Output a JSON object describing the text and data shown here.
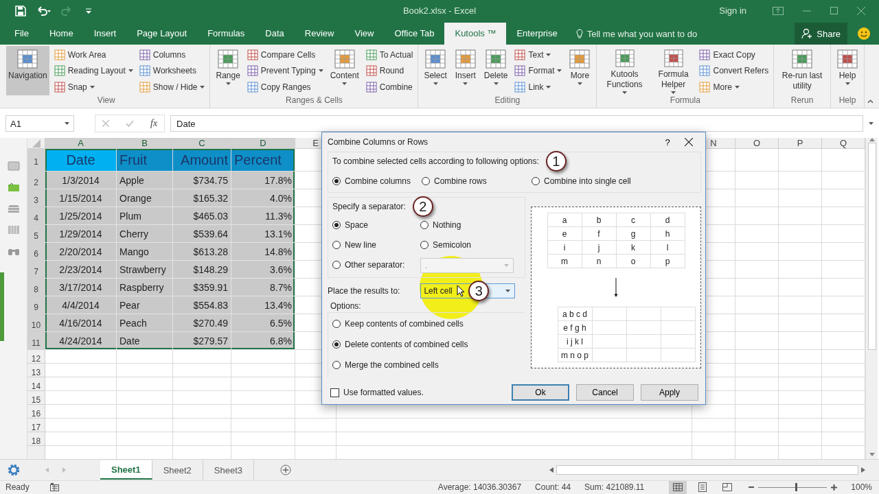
{
  "window": {
    "title": "Book2.xlsx  -  Excel",
    "sign_in": "Sign in"
  },
  "ribbon_tabs": [
    {
      "label": "File",
      "selected": false
    },
    {
      "label": "Home",
      "selected": false
    },
    {
      "label": "Insert",
      "selected": false
    },
    {
      "label": "Page Layout",
      "selected": false
    },
    {
      "label": "Formulas",
      "selected": false
    },
    {
      "label": "Data",
      "selected": false
    },
    {
      "label": "Review",
      "selected": false
    },
    {
      "label": "View",
      "selected": false
    },
    {
      "label": "Office Tab",
      "selected": false
    },
    {
      "label": "Kutools ™",
      "selected": true
    },
    {
      "label": "Enterprise",
      "selected": false
    }
  ],
  "tell_me": {
    "placeholder": "Tell me what you want to do"
  },
  "share": "Share",
  "ribbon": {
    "groups": [
      {
        "label": "View",
        "items": [
          {
            "kind": "large",
            "label": "Navigation",
            "dropdown": false,
            "on": true
          },
          {
            "kind": "stack",
            "items": [
              {
                "label": "Work Area",
                "dropdown": false,
                "on": false
              },
              {
                "label": "Reading Layout",
                "dropdown": true,
                "on": false
              },
              {
                "label": "Snap",
                "dropdown": true,
                "on": false
              }
            ]
          },
          {
            "kind": "stack",
            "items": [
              {
                "label": "Columns",
                "dropdown": false,
                "on": false
              },
              {
                "label": "Worksheets",
                "dropdown": false,
                "on": false
              },
              {
                "label": "Show / Hide",
                "dropdown": true,
                "on": false
              }
            ]
          }
        ]
      },
      {
        "label": "Ranges & Cells",
        "items": [
          {
            "kind": "large",
            "label": "Range",
            "dropdown": true,
            "on": false
          },
          {
            "kind": "stack",
            "items": [
              {
                "label": "Compare Cells",
                "dropdown": false,
                "on": false
              },
              {
                "label": "Prevent Typing",
                "dropdown": true,
                "on": false
              },
              {
                "label": "Copy Ranges",
                "dropdown": false,
                "on": false
              }
            ]
          },
          {
            "kind": "large",
            "label": "Content",
            "dropdown": true,
            "on": false
          },
          {
            "kind": "stack",
            "items": [
              {
                "label": "To Actual",
                "dropdown": false,
                "on": false
              },
              {
                "label": "Round",
                "dropdown": false,
                "on": false
              },
              {
                "label": "Combine",
                "dropdown": false,
                "on": false
              }
            ]
          }
        ]
      },
      {
        "label": "Editing",
        "items": [
          {
            "kind": "large",
            "label": "Select",
            "dropdown": true,
            "on": false
          },
          {
            "kind": "large",
            "label": "Insert",
            "dropdown": true,
            "on": false
          },
          {
            "kind": "large",
            "label": "Delete",
            "dropdown": true,
            "on": false
          },
          {
            "kind": "stack",
            "items": [
              {
                "label": "Text",
                "dropdown": true,
                "on": false
              },
              {
                "label": "Format",
                "dropdown": true,
                "on": false
              },
              {
                "label": "Link",
                "dropdown": true,
                "on": false
              }
            ]
          },
          {
            "kind": "large",
            "label": "More",
            "dropdown": true,
            "on": false
          }
        ]
      },
      {
        "label": "Formula",
        "items": [
          {
            "kind": "large",
            "label": "Kutools Functions",
            "dropdown": true,
            "on": false
          },
          {
            "kind": "large",
            "label": "Formula Helper",
            "dropdown": true,
            "on": false
          },
          {
            "kind": "stack",
            "items": [
              {
                "label": "Exact Copy",
                "dropdown": false,
                "on": false
              },
              {
                "label": "Convert Refers",
                "dropdown": false,
                "on": false
              },
              {
                "label": "More",
                "dropdown": true,
                "on": false
              }
            ]
          }
        ]
      },
      {
        "label": "Rerun",
        "items": [
          {
            "kind": "large",
            "label": "Re-run last utility",
            "dropdown": false,
            "on": false
          }
        ]
      },
      {
        "label": "Help",
        "items": [
          {
            "kind": "large",
            "label": "Help",
            "dropdown": true,
            "on": false
          }
        ]
      }
    ]
  },
  "formula_bar": {
    "name_box": "A1",
    "fx": "fx",
    "value": "Date"
  },
  "sheet": {
    "columns": [
      {
        "label": "A",
        "selected": true
      },
      {
        "label": "B",
        "selected": true
      },
      {
        "label": "C",
        "selected": true
      },
      {
        "label": "D",
        "selected": true
      },
      {
        "label": "E",
        "selected": false
      },
      {
        "label": "N",
        "selected": false
      },
      {
        "label": "O",
        "selected": false
      },
      {
        "label": "P",
        "selected": false
      },
      {
        "label": "Q",
        "selected": false
      }
    ],
    "rows": [
      {
        "number": "1",
        "selected": true,
        "cells": [
          "Date",
          "Fruit",
          "Amount",
          "Percent"
        ]
      },
      {
        "number": "2",
        "selected": true,
        "cells": [
          "1/3/2014",
          "Apple",
          "$734.75",
          "17.8%"
        ]
      },
      {
        "number": "3",
        "selected": true,
        "cells": [
          "1/15/2014",
          "Orange",
          "$165.32",
          "4.0%"
        ]
      },
      {
        "number": "4",
        "selected": true,
        "cells": [
          "1/25/2014",
          "Plum",
          "$465.03",
          "11.3%"
        ]
      },
      {
        "number": "5",
        "selected": true,
        "cells": [
          "1/29/2014",
          "Cherry",
          "$539.64",
          "13.1%"
        ]
      },
      {
        "number": "6",
        "selected": true,
        "cells": [
          "2/20/2014",
          "Mango",
          "$613.28",
          "14.8%"
        ]
      },
      {
        "number": "7",
        "selected": true,
        "cells": [
          "2/23/2014",
          "Strawberry",
          "$148.29",
          "3.6%"
        ]
      },
      {
        "number": "8",
        "selected": true,
        "cells": [
          "3/17/2014",
          "Raspberry",
          "$359.91",
          "8.7%"
        ]
      },
      {
        "number": "9",
        "selected": true,
        "cells": [
          "4/4/2014",
          "Pear",
          "$554.83",
          "13.4%"
        ]
      },
      {
        "number": "10",
        "selected": true,
        "cells": [
          "4/16/2014",
          "Peach",
          "$270.49",
          "6.5%"
        ]
      },
      {
        "number": "11",
        "selected": true,
        "cells": [
          "4/24/2014",
          "Date",
          "$279.57",
          "6.8%"
        ]
      },
      {
        "number": "12",
        "selected": false
      },
      {
        "number": "13",
        "selected": false
      },
      {
        "number": "14",
        "selected": false
      },
      {
        "number": "15",
        "selected": false
      },
      {
        "number": "16",
        "selected": false
      },
      {
        "number": "17",
        "selected": false
      },
      {
        "number": "18",
        "selected": false
      }
    ]
  },
  "dialog": {
    "title": "Combine Columns or Rows",
    "help": "?",
    "combine": {
      "label": "To combine selected cells according to following options:",
      "callout": "1",
      "options": [
        {
          "label": "Combine columns",
          "selected": true
        },
        {
          "label": "Combine rows",
          "selected": false
        },
        {
          "label": "Combine into single cell",
          "selected": false
        }
      ]
    },
    "separator": {
      "label": "Specify a separator:",
      "callout": "2",
      "options": [
        {
          "label": "Space",
          "selected": true
        },
        {
          "label": "Nothing",
          "selected": false
        },
        {
          "label": "New line",
          "selected": false
        },
        {
          "label": "Semicolon",
          "selected": false
        },
        {
          "label": "Other separator:",
          "selected": false
        }
      ],
      "other": {
        "value": ".",
        "disabled": true
      }
    },
    "place": {
      "label": "Place the results to:",
      "value": "Left cell",
      "callout": "3"
    },
    "options": {
      "label": "Options:",
      "items": [
        {
          "label": "Keep contents of combined cells",
          "selected": false
        },
        {
          "label": "Delete contents of combined cells",
          "selected": true
        },
        {
          "label": "Merge the combined cells",
          "selected": false
        }
      ]
    },
    "formatted": {
      "label": "Use formatted values.",
      "checked": false
    },
    "preview": {
      "source": [
        [
          "a",
          "b",
          "c",
          "d"
        ],
        [
          "e",
          "f",
          "g",
          "h"
        ],
        [
          "i",
          "j",
          "k",
          "l"
        ],
        [
          "m",
          "n",
          "o",
          "p"
        ]
      ],
      "result": [
        "a b c d",
        "e f g h",
        "i j k l",
        "m n o p"
      ]
    },
    "buttons": [
      {
        "label": "Ok",
        "default": true
      },
      {
        "label": "Cancel",
        "default": false
      },
      {
        "label": "Apply",
        "default": false
      }
    ]
  },
  "sheet_tabs": [
    {
      "label": "Sheet1",
      "selected": true
    },
    {
      "label": "Sheet2",
      "selected": false
    },
    {
      "label": "Sheet3",
      "selected": false
    }
  ],
  "status_bar": {
    "mode": "Ready",
    "stats": [
      "Average: 14036.30367",
      "Count: 44",
      "Sum: 421089.11"
    ],
    "zoom": {
      "level": 0.55,
      "reading": "100%"
    }
  }
}
